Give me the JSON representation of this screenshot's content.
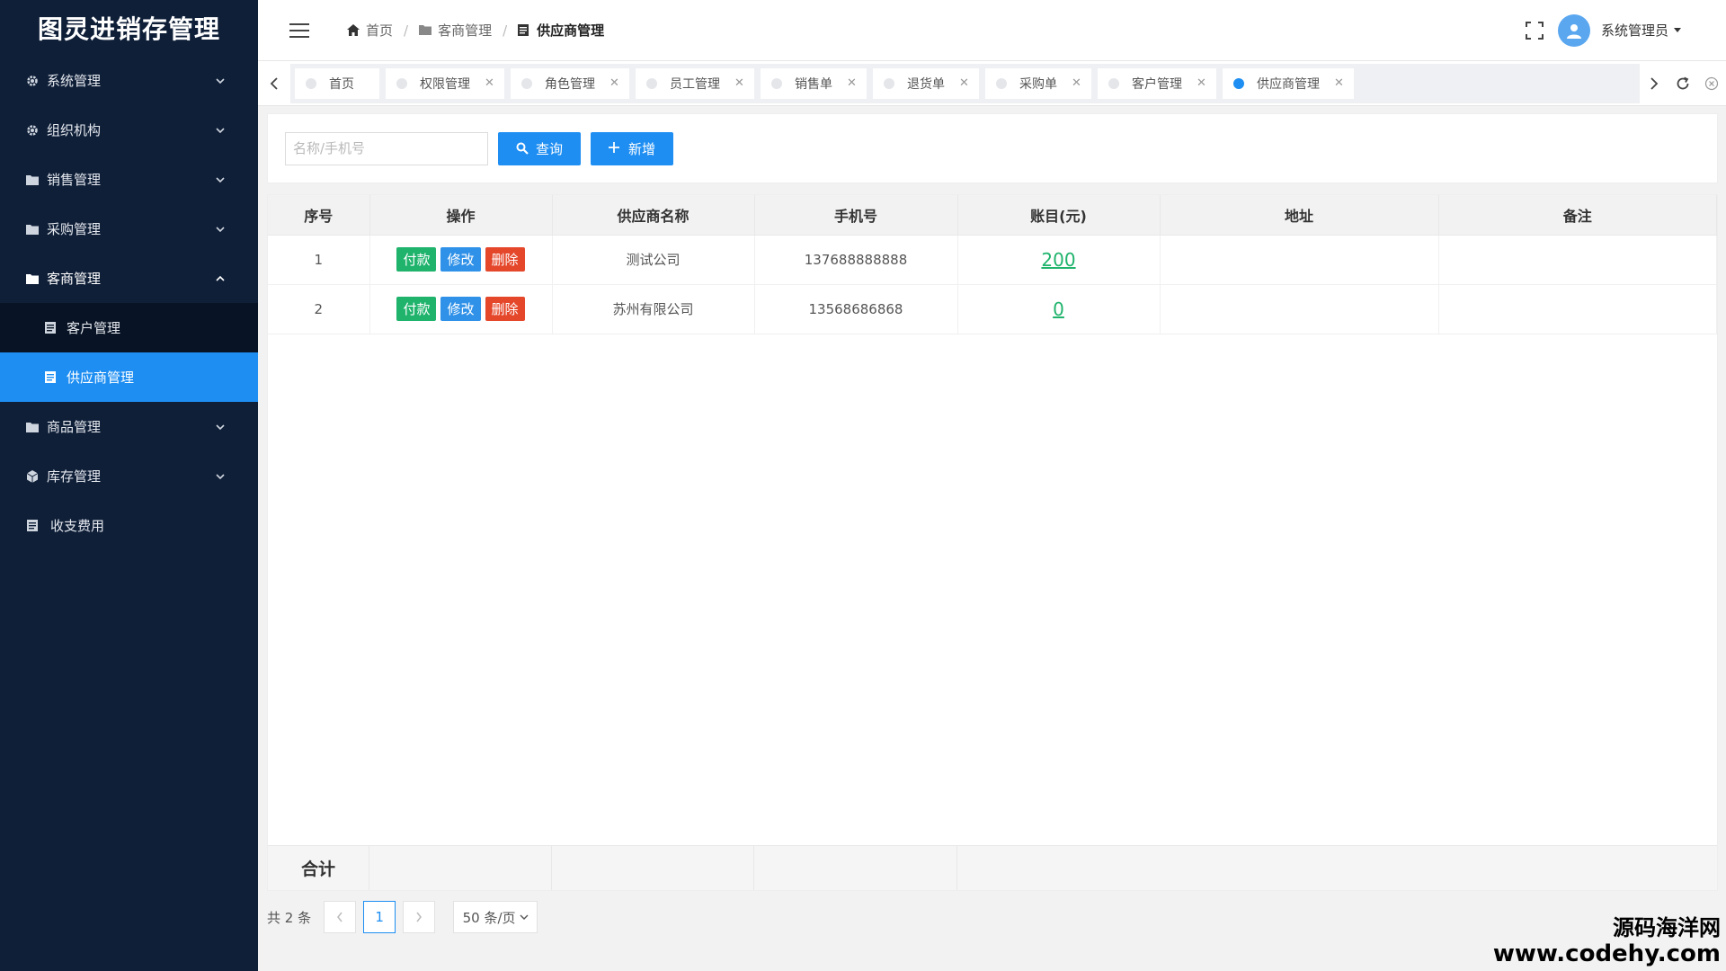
{
  "app": {
    "title": "图灵进销存管理"
  },
  "sidebar": {
    "items": [
      {
        "label": "系统管理",
        "icon": "gear-icon"
      },
      {
        "label": "组织机构",
        "icon": "gear-icon"
      },
      {
        "label": "销售管理",
        "icon": "folder-icon"
      },
      {
        "label": "采购管理",
        "icon": "folder-icon"
      },
      {
        "label": "客商管理",
        "icon": "folder-icon",
        "expanded": true
      },
      {
        "label": "商品管理",
        "icon": "folder-icon"
      },
      {
        "label": "库存管理",
        "icon": "cube-icon"
      },
      {
        "label": "收支费用",
        "icon": "document-icon"
      }
    ],
    "subitems": [
      {
        "label": "客户管理"
      },
      {
        "label": "供应商管理",
        "active": true
      }
    ]
  },
  "header": {
    "breadcrumb": [
      "首页",
      "客商管理",
      "供应商管理"
    ],
    "user": "系统管理员"
  },
  "tabs": [
    {
      "label": "首页",
      "closable": false
    },
    {
      "label": "权限管理",
      "closable": true
    },
    {
      "label": "角色管理",
      "closable": true
    },
    {
      "label": "员工管理",
      "closable": true
    },
    {
      "label": "销售单",
      "closable": true
    },
    {
      "label": "退货单",
      "closable": true
    },
    {
      "label": "采购单",
      "closable": true
    },
    {
      "label": "客户管理",
      "closable": true
    },
    {
      "label": "供应商管理",
      "closable": true,
      "active": true
    }
  ],
  "search": {
    "placeholder": "名称/手机号",
    "query_label": "查询",
    "add_label": "新增"
  },
  "table": {
    "columns": [
      "序号",
      "操作",
      "供应商名称",
      "手机号",
      "账目(元)",
      "地址",
      "备注"
    ],
    "actions": {
      "pay": "付款",
      "edit": "修改",
      "delete": "删除"
    },
    "rows": [
      {
        "index": "1",
        "name": "测试公司",
        "phone": "137688888888",
        "amount": "200",
        "address": "",
        "remark": ""
      },
      {
        "index": "2",
        "name": "苏州有限公司",
        "phone": "13568686868",
        "amount": "0",
        "address": "",
        "remark": ""
      }
    ],
    "total_label": "合计"
  },
  "pagination": {
    "total_text": "共 2 条",
    "current_page": "1",
    "page_size": "50 条/页"
  },
  "watermark": {
    "line1": "源码海洋网",
    "line2": "www.codehy.com"
  },
  "colors": {
    "sidebar_bg": "#0f1f38",
    "accent": "#1e8ef2",
    "pay": "#1fb36c",
    "edit": "#2f91e8",
    "delete": "#e5472b"
  }
}
